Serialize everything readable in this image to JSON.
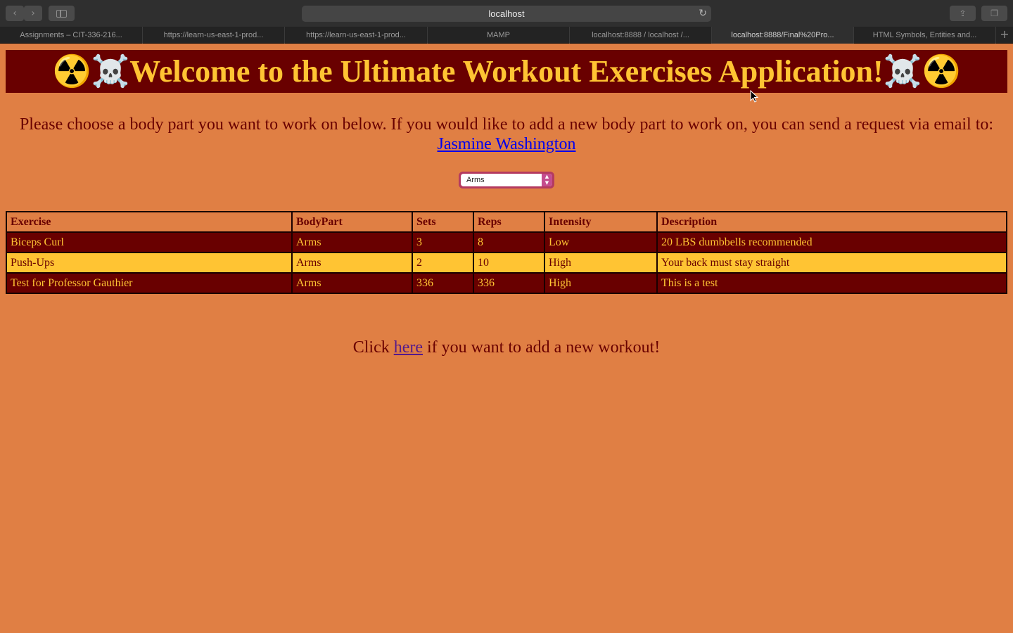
{
  "browser": {
    "url": "localhost",
    "tabs": [
      "Assignments – CIT-336-216...",
      "https://learn-us-east-1-prod...",
      "https://learn-us-east-1-prod...",
      "MAMP",
      "localhost:8888 / localhost /...",
      "localhost:8888/Final%20Pro...",
      "HTML Symbols, Entities and..."
    ],
    "active_tab_index": 5
  },
  "page": {
    "banner_title": "☢️☠️Welcome to the Ultimate Workout Exercises Application!☠️☢️",
    "intro_text": "Please choose a body part you want to work on below. If you would like to add a new body part to work on, you can send a request via email to:",
    "contact_link": "Jasmine Washington",
    "body_part_select": {
      "selected": "Arms"
    },
    "table": {
      "headers": [
        "Exercise",
        "BodyPart",
        "Sets",
        "Reps",
        "Intensity",
        "Description"
      ],
      "rows": [
        [
          "Biceps Curl",
          "Arms",
          "3",
          "8",
          "Low",
          "20 LBS dumbbells recommended"
        ],
        [
          "Push-Ups",
          "Arms",
          "2",
          "10",
          "High",
          "Your back must stay straight"
        ],
        [
          "Test for Professor Gauthier",
          "Arms",
          "336",
          "336",
          "High",
          "This is a test"
        ]
      ]
    },
    "add_workout": {
      "prefix": "Click",
      "link": "here",
      "suffix": "if you want to add a new workout!"
    }
  },
  "colors": {
    "page_background": "#e07f44",
    "banner_background": "#690000",
    "banner_text": "#ffc433",
    "row_light": "#ffc433",
    "row_dark": "#690000"
  },
  "icons": [
    "back-icon",
    "forward-icon",
    "sidebar-icon",
    "reload-icon",
    "share-icon",
    "tabs-overview-icon",
    "new-tab-icon",
    "mouse-cursor-icon"
  ]
}
